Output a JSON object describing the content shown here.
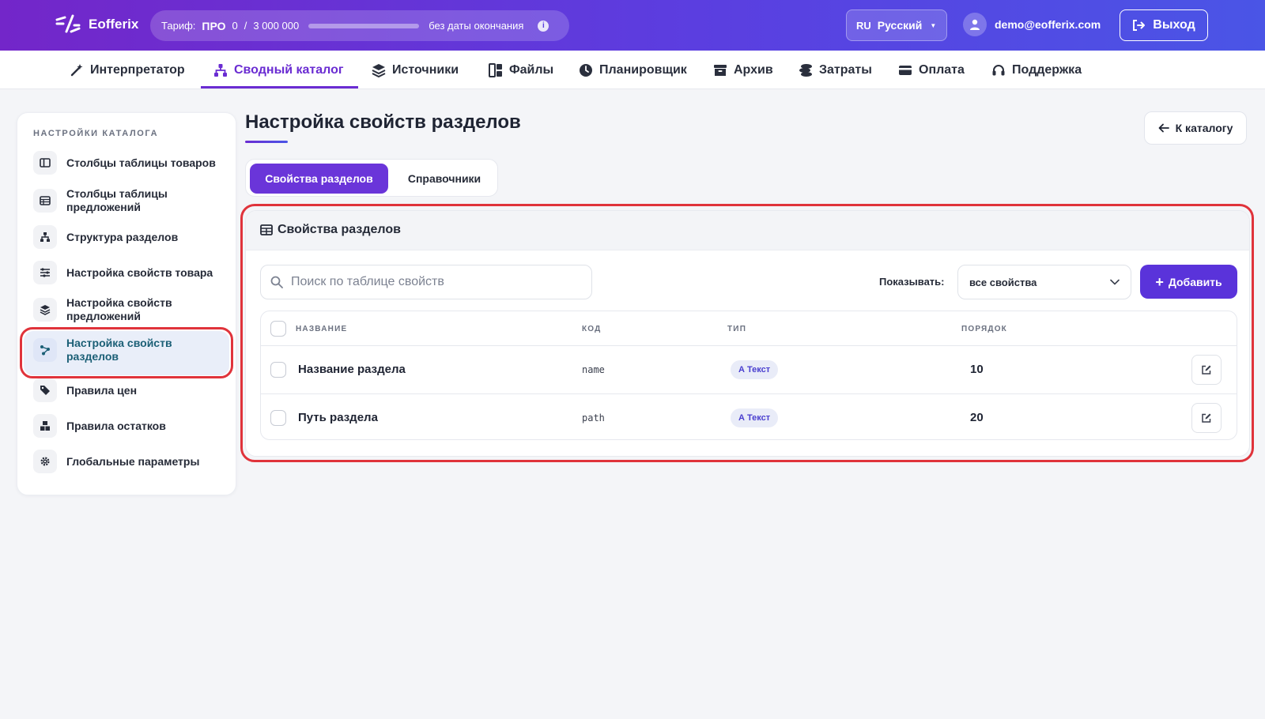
{
  "app": {
    "name": "Eofferix"
  },
  "plan": {
    "label": "Тариф:",
    "name": "ПРО",
    "usage_used": "0",
    "usage_sep": "/",
    "usage_limit": "3 000 000",
    "usage_fraction": 0,
    "expiry": "без даты окончания"
  },
  "language": {
    "code": "RU",
    "label": "Русский"
  },
  "user": {
    "email": "demo@eofferix.com"
  },
  "logout_label": "Выход",
  "nav": [
    {
      "label": "Интерпретатор",
      "icon": "magic-wand-icon"
    },
    {
      "label": "Сводный каталог",
      "icon": "sitemap-icon",
      "active": true
    },
    {
      "label": "Источники",
      "icon": "layers-icon"
    },
    {
      "label": "Файлы",
      "icon": "files-icon"
    },
    {
      "label": "Планировщик",
      "icon": "clock-icon"
    },
    {
      "label": "Архив",
      "icon": "archive-icon"
    },
    {
      "label": "Затраты",
      "icon": "coins-icon"
    },
    {
      "label": "Оплата",
      "icon": "credit-card-icon"
    },
    {
      "label": "Поддержка",
      "icon": "headset-icon"
    }
  ],
  "sidebar": {
    "title": "НАСТРОЙКИ КАТАЛОГА",
    "items": [
      {
        "label": "Столбцы таблицы товаров",
        "icon": "columns-icon"
      },
      {
        "label": "Столбцы таблицы предложений",
        "icon": "table-icon"
      },
      {
        "label": "Структура разделов",
        "icon": "hierarchy-icon"
      },
      {
        "label": "Настройка свойств товара",
        "icon": "sliders-icon"
      },
      {
        "label": "Настройка свойств предложений",
        "icon": "layers-icon"
      },
      {
        "label": "Настройка свойств разделов",
        "icon": "share-nodes-icon",
        "active": true
      },
      {
        "label": "Правила цен",
        "icon": "tags-icon"
      },
      {
        "label": "Правила остатков",
        "icon": "boxes-icon"
      },
      {
        "label": "Глобальные параметры",
        "icon": "gear-icon"
      }
    ]
  },
  "page": {
    "title": "Настройка свойств разделов",
    "back_label": "К каталогу",
    "tabs": [
      {
        "label": "Свойства разделов",
        "active": true
      },
      {
        "label": "Справочники"
      }
    ]
  },
  "card": {
    "title": "Свойства разделов",
    "search_placeholder": "Поиск по таблице свойств",
    "show_label": "Показывать:",
    "show_value": "все свойства",
    "add_label": "Добавить",
    "columns": [
      "НАЗВАНИЕ",
      "КОД",
      "ТИП",
      "ПОРЯДОК"
    ],
    "rows": [
      {
        "name": "Название раздела",
        "code": "name",
        "type": "Текст",
        "type_prefix": "A",
        "order": "10"
      },
      {
        "name": "Путь раздела",
        "code": "path",
        "type": "Текст",
        "type_prefix": "A",
        "order": "20"
      }
    ]
  },
  "colors": {
    "accent": "#6a2cd2",
    "primary_button": "#5a33da",
    "highlight": "#e0333b"
  }
}
